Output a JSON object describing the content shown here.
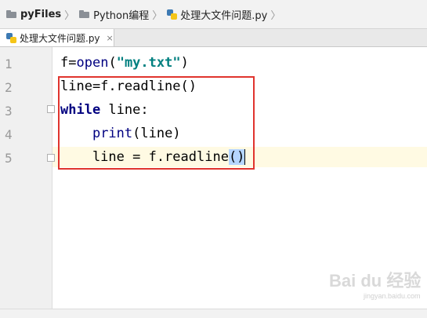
{
  "breadcrumb": {
    "items": [
      "pyFiles",
      "Python编程",
      "处理大文件问题.py"
    ]
  },
  "tabs": [
    {
      "label": "处理大文件问题.py",
      "close": "×"
    }
  ],
  "editor": {
    "line_numbers": [
      "1",
      "2",
      "3",
      "4",
      "5"
    ],
    "lines": {
      "l1": {
        "a": "f",
        "b": "=",
        "c": "open",
        "d": "(",
        "e": "\"my.txt\"",
        "f": ")"
      },
      "l2": {
        "a": "line=f.readline()"
      },
      "l3": {
        "a": "while",
        "b": " line:"
      },
      "l4": {
        "a": "    ",
        "b": "print",
        "c": "(line)"
      },
      "l5": {
        "a": "    line = f.readline",
        "b": "()"
      }
    }
  },
  "watermark": {
    "text": "Bai du 经验",
    "sub": "jingyan.baidu.com"
  }
}
